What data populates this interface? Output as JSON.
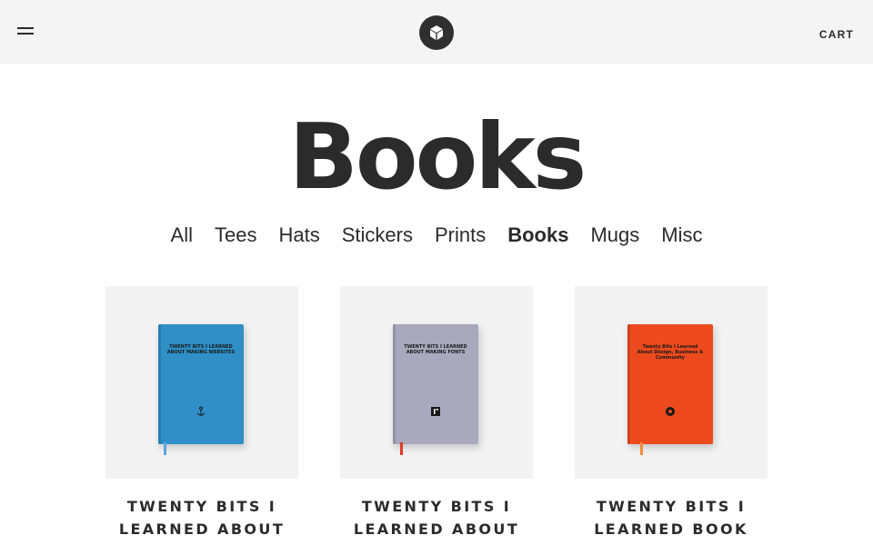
{
  "header": {
    "menu_icon": "hamburger-menu-icon",
    "logo_icon": "cube-logo-icon",
    "cart_label": "CART"
  },
  "page": {
    "title": "Books"
  },
  "categories": [
    {
      "label": "All",
      "active": false
    },
    {
      "label": "Tees",
      "active": false
    },
    {
      "label": "Hats",
      "active": false
    },
    {
      "label": "Stickers",
      "active": false
    },
    {
      "label": "Prints",
      "active": false
    },
    {
      "label": "Books",
      "active": true
    },
    {
      "label": "Mugs",
      "active": false
    },
    {
      "label": "Misc",
      "active": false
    }
  ],
  "products": [
    {
      "name": "TWENTY BITS I LEARNED ABOUT MAKING WEBSITES",
      "cover_title": "TWENTY BITS I LEARNED ABOUT MAKING WEBSITES",
      "cover_color": "#2f8fc6",
      "ribbon_color": "#5aa8e0"
    },
    {
      "name": "TWENTY BITS I LEARNED ABOUT MAKING FONTS",
      "cover_title": "TWENTY BITS I LEARNED ABOUT MAKING FONTS",
      "cover_color": "#a9a8bd",
      "ribbon_color": "#e03a2c"
    },
    {
      "name": "TWENTY BITS I LEARNED BOOK",
      "cover_title": "Twenty Bits I Learned About Design, Business & Community",
      "cover_color": "#ec4a1e",
      "ribbon_color": "#f08a3a"
    }
  ]
}
